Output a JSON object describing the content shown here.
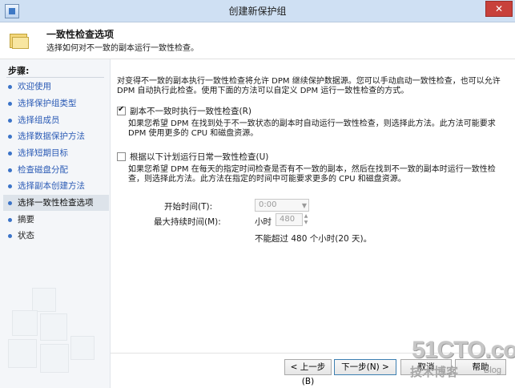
{
  "window": {
    "title": "创建新保护组"
  },
  "header": {
    "title": "一致性检查选项",
    "subtitle": "选择如何对不一致的副本运行一致性检查。"
  },
  "sidebar": {
    "steps_label": "步骤:",
    "steps": [
      {
        "label": "欢迎使用",
        "state": "done"
      },
      {
        "label": "选择保护组类型",
        "state": "done"
      },
      {
        "label": "选择组成员",
        "state": "done"
      },
      {
        "label": "选择数据保护方法",
        "state": "done"
      },
      {
        "label": "选择短期目标",
        "state": "done"
      },
      {
        "label": "检查磁盘分配",
        "state": "done"
      },
      {
        "label": "选择副本创建方法",
        "state": "done"
      },
      {
        "label": "选择一致性检查选项",
        "state": "current"
      },
      {
        "label": "摘要",
        "state": "todo"
      },
      {
        "label": "状态",
        "state": "todo"
      }
    ]
  },
  "main": {
    "intro": "对变得不一致的副本执行一致性检查将允许 DPM 继续保护数据源。您可以手动启动一致性检查，也可以允许 DPM 自动执行此检查。使用下面的方法可以自定义 DPM 运行一致性检查的方式。",
    "option1": {
      "label": "副本不一致时执行一致性检查(R)",
      "checked": true,
      "description": "如果您希望 DPM 在找到处于不一致状态的副本时自动运行一致性检查，则选择此方法。此方法可能要求 DPM 使用更多的 CPU 和磁盘资源。"
    },
    "option2": {
      "label": "根据以下计划运行日常一致性检查(U)",
      "checked": false,
      "description": "如果您希望 DPM 在每天的指定时间检查是否有不一致的副本，然后在找到不一致的副本时运行一致性检查，则选择此方法。此方法在指定的时间中可能要求更多的 CPU 和磁盘资源。"
    },
    "start_time_label": "开始时间(T):",
    "start_time_value": "0:00",
    "max_duration_label": "最大持续时间(M):",
    "hours_unit": "小时",
    "hours_value": "480",
    "limit_note": "不能超过 480 个小时(20 天)。"
  },
  "footer": {
    "back_label": "< 上一步(B)",
    "next_label": "下一步(N) >",
    "cancel_label": "取消",
    "help_label": "帮助"
  },
  "watermark": {
    "site": "51CTO.com",
    "tagline": "技术博客",
    "blog": "Blog"
  },
  "colors": {
    "accent": "#3b73c8",
    "titlebar": "#cfe0f3",
    "close": "#c8413b"
  }
}
